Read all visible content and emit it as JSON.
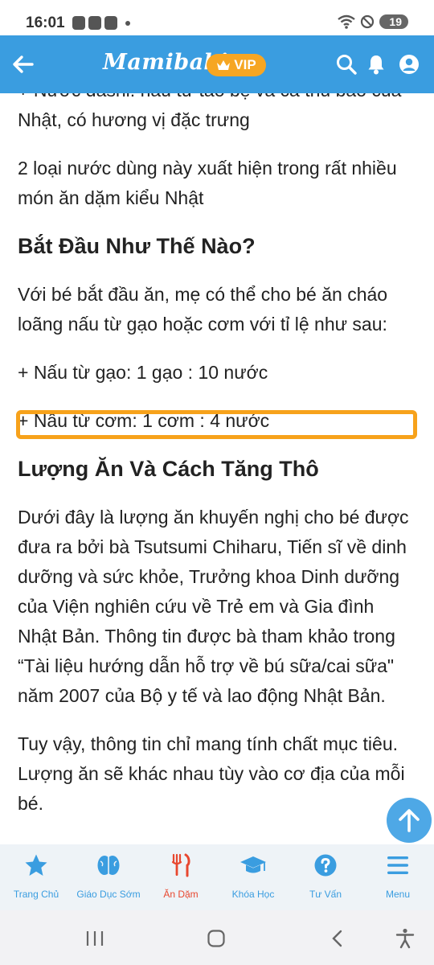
{
  "status_bar": {
    "time": "16:01",
    "battery": "19"
  },
  "header": {
    "logo": "Mamibabi",
    "vip_label": "VIP",
    "colors": {
      "bar": "#3a9de0",
      "vip": "#f6a623"
    }
  },
  "article": {
    "paragraphs": [
      "+ Nước dashi: nấu từ tảo bẹ và cá thu bào của Nhật, có hương vị đặc trưng",
      "2 loại nước dùng này xuất hiện trong rất nhiều món ăn dặm kiểu Nhật",
      "Bắt Đầu Như Thế Nào?",
      "Với bé bắt đầu ăn, mẹ có thể cho bé ăn cháo loãng nấu từ gạo hoặc cơm với tỉ lệ như sau:",
      "+ Nấu từ gạo: 1 gạo : 10 nước",
      "+ Nấu từ cơm: 1 cơm : 4 nước",
      "Lượng Ăn Và Cách Tăng Thô",
      "Dưới đây là lượng ăn khuyến nghị cho bé được đưa ra bởi bà Tsutsumi Chiharu, Tiến sĩ về dinh dưỡng và sức khỏe, Trưởng khoa Dinh dưỡng của Viện nghiên cứu về Trẻ em và Gia đình Nhật Bản. Thông tin được bà tham khảo trong “Tài liệu hướng dẫn hỗ trợ về bú sữa/cai sữa\" năm 2007 của Bộ y tế và lao động Nhật Bản.",
      "Tuy vậy, thông tin chỉ mang tính chất mục tiêu. Lượng ăn sẽ khác nhau tùy vào cơ địa của mỗi bé."
    ],
    "highlight_color": "#f7a21b"
  },
  "bottom_nav": {
    "items": [
      {
        "label": "Trang Chủ",
        "icon": "star-icon"
      },
      {
        "label": "Giáo Dục Sớm",
        "icon": "brain-icon"
      },
      {
        "label": "Ăn Dặm",
        "icon": "fork-knife-icon"
      },
      {
        "label": "Khóa Học",
        "icon": "graduation-cap-icon"
      },
      {
        "label": "Tư Vấn",
        "icon": "question-circle-icon"
      },
      {
        "label": "Menu",
        "icon": "hamburger-menu-icon"
      }
    ],
    "active_index": 2,
    "colors": {
      "default": "#3a9de0",
      "active": "#e8472f"
    }
  }
}
